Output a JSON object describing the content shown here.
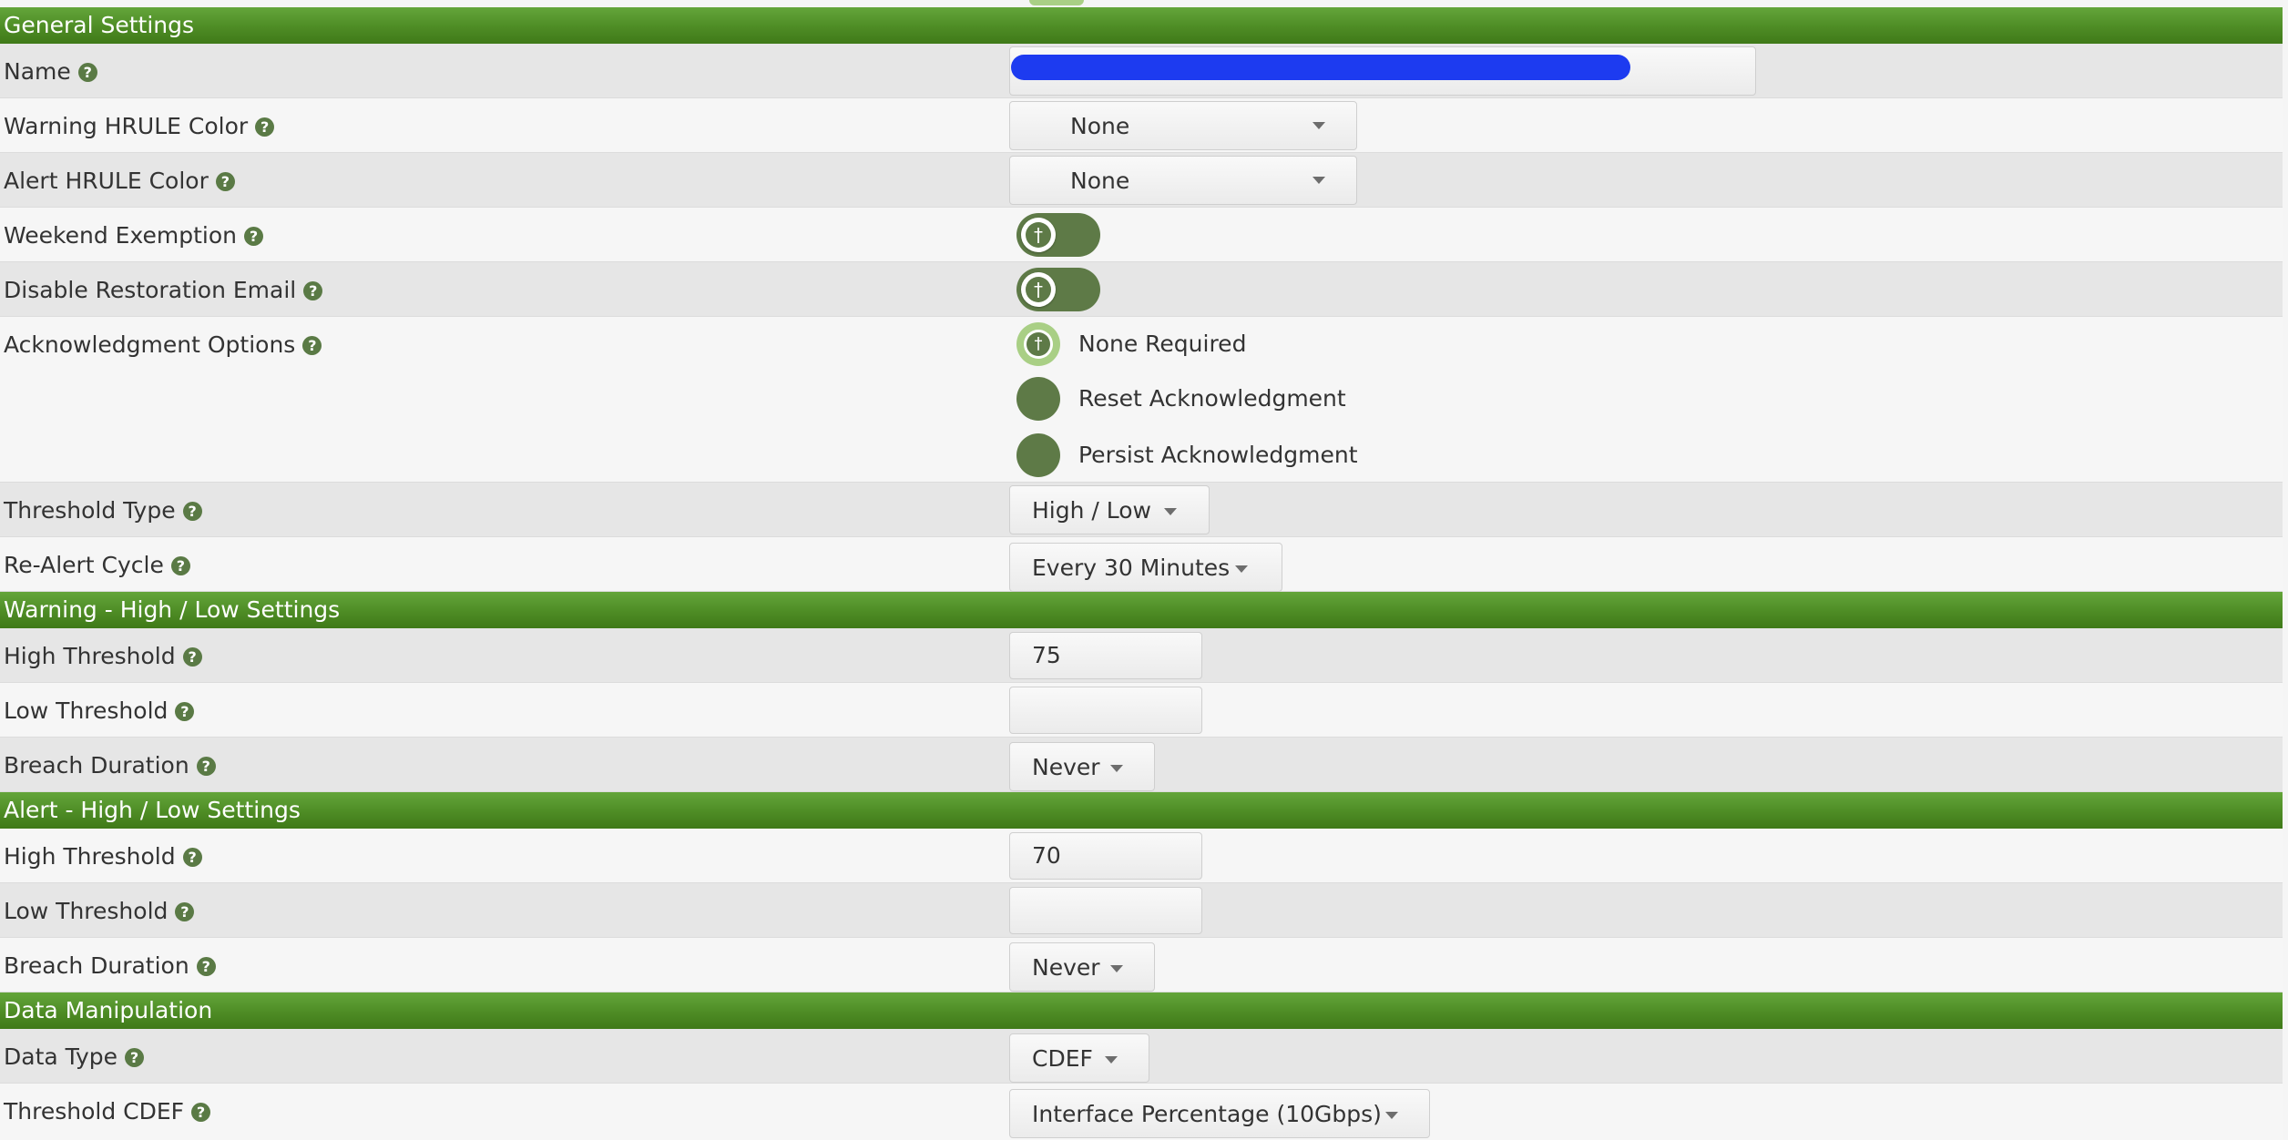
{
  "sections": {
    "general": "General Settings",
    "warning": "Warning - High / Low Settings",
    "alert": "Alert - High / Low Settings",
    "data": "Data Manipulation"
  },
  "help_glyph": "?",
  "general": {
    "name": {
      "label": "Name",
      "value": ""
    },
    "warning_hrule_color": {
      "label": "Warning HRULE Color",
      "value": "None"
    },
    "alert_hrule_color": {
      "label": "Alert HRULE Color",
      "value": "None"
    },
    "weekend_exemption": {
      "label": "Weekend Exemption",
      "on": false
    },
    "disable_restoration_email": {
      "label": "Disable Restoration Email",
      "on": false
    },
    "acknowledgment_options": {
      "label": "Acknowledgment Options",
      "options": [
        "None Required",
        "Reset Acknowledgment",
        "Persist Acknowledgment"
      ],
      "selected": "None Required"
    },
    "threshold_type": {
      "label": "Threshold Type",
      "value": "High / Low"
    },
    "re_alert_cycle": {
      "label": "Re-Alert Cycle",
      "value": "Every 30 Minutes"
    }
  },
  "warning": {
    "high_threshold": {
      "label": "High Threshold",
      "value": "75"
    },
    "low_threshold": {
      "label": "Low Threshold",
      "value": ""
    },
    "breach_duration": {
      "label": "Breach Duration",
      "value": "Never"
    }
  },
  "alert": {
    "high_threshold": {
      "label": "High Threshold",
      "value": "70"
    },
    "low_threshold": {
      "label": "Low Threshold",
      "value": ""
    },
    "breach_duration": {
      "label": "Breach Duration",
      "value": "Never"
    }
  },
  "data_manipulation": {
    "data_type": {
      "label": "Data Type",
      "value": "CDEF"
    },
    "threshold_cdef": {
      "label": "Threshold CDEF",
      "value": "Interface Percentage (10Gbps)"
    }
  },
  "colors": {
    "section_header": "#4e8c25",
    "control_green": "#5e7a47",
    "radio_checked_ring": "#a9cf85",
    "redaction": "#1d3bf0"
  }
}
